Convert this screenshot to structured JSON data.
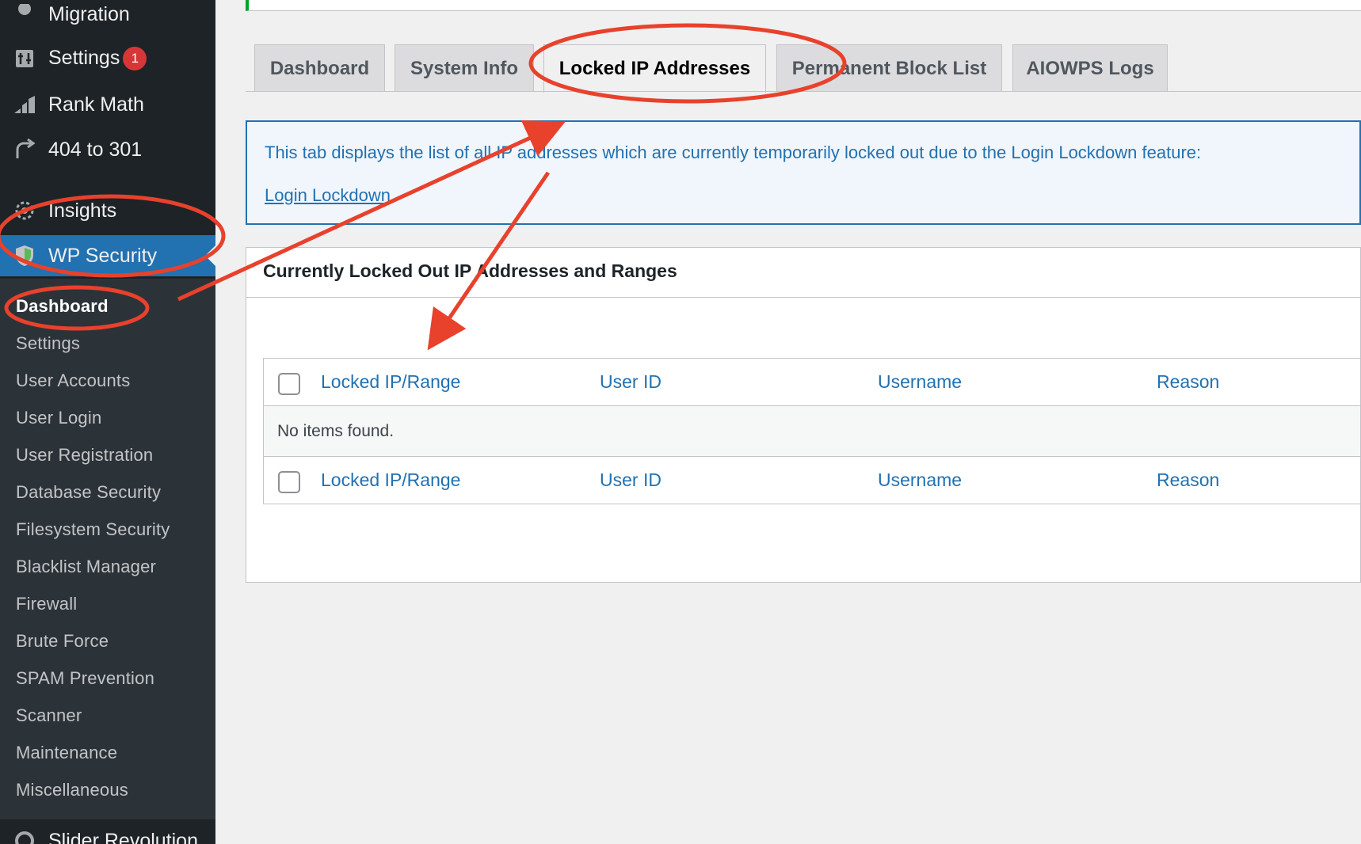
{
  "sidebar": {
    "menu": [
      {
        "label": "Migration",
        "icon": "migration-icon"
      },
      {
        "label": "Settings",
        "icon": "settings-icon",
        "badge": "1"
      },
      {
        "label": "Rank Math",
        "icon": "rank-math-icon"
      },
      {
        "label": "404 to 301",
        "icon": "redirect-icon"
      },
      {
        "label": "Insights",
        "icon": "insights-icon"
      },
      {
        "label": "WP Security",
        "icon": "shield-icon"
      },
      {
        "label": "Slider Revolution",
        "icon": "slider-revolution-icon"
      }
    ],
    "submenu": [
      "Dashboard",
      "Settings",
      "User Accounts",
      "User Login",
      "User Registration",
      "Database Security",
      "Filesystem Security",
      "Blacklist Manager",
      "Firewall",
      "Brute Force",
      "SPAM Prevention",
      "Scanner",
      "Maintenance",
      "Miscellaneous"
    ]
  },
  "tabs": [
    "Dashboard",
    "System Info",
    "Locked IP Addresses",
    "Permanent Block List",
    "AIOWPS Logs"
  ],
  "notice": {
    "text": "This tab displays the list of all IP addresses which are currently temporarily locked out due to the Login Lockdown feature:",
    "link": "Login Lockdown"
  },
  "postbox": {
    "title": "Currently Locked Out IP Addresses and Ranges"
  },
  "table": {
    "columns": [
      "Locked IP/Range",
      "User ID",
      "Username",
      "Reason"
    ],
    "empty_message": "No items found."
  },
  "colors": {
    "sidebar_bg": "#1d2327",
    "submenu_bg": "#2c3338",
    "accent": "#2271b1",
    "annotation": "#e8412c"
  }
}
